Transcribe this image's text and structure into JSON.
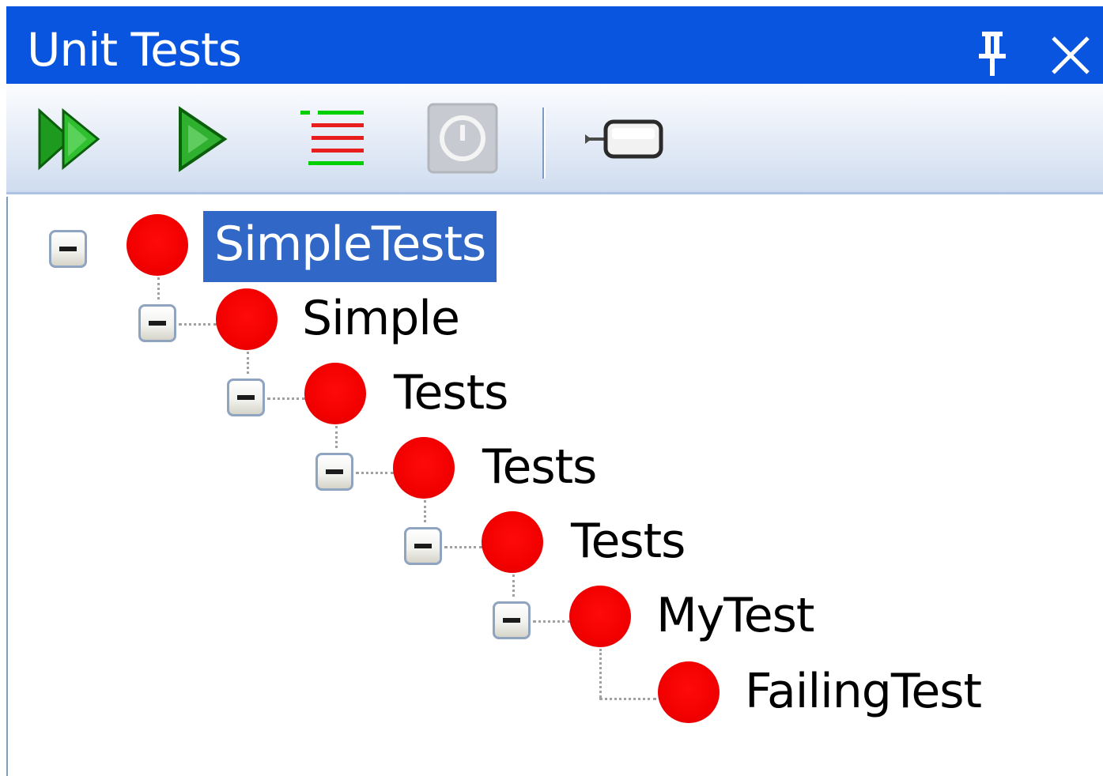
{
  "window": {
    "title": "Unit Tests",
    "titlebar_color": "#0a55e0"
  },
  "titlebar_buttons": [
    {
      "name": "pin",
      "icon": "pin-icon"
    },
    {
      "name": "close",
      "icon": "close-icon"
    }
  ],
  "toolbar": {
    "buttons": [
      {
        "name": "run-all",
        "icon": "double-play-icon"
      },
      {
        "name": "run",
        "icon": "play-icon"
      },
      {
        "name": "show-results",
        "icon": "results-list-icon"
      },
      {
        "name": "stop",
        "icon": "stop-icon",
        "enabled": false
      },
      {
        "name": "attach",
        "icon": "attach-icon"
      }
    ]
  },
  "tree": {
    "status_color": "#f20000",
    "selected_color": "#3168c8",
    "nodes": [
      {
        "label": "SimpleTests",
        "depth": 0,
        "status": "failed",
        "expanded": true,
        "selected": true
      },
      {
        "label": "Simple",
        "depth": 1,
        "status": "failed",
        "expanded": true,
        "selected": false
      },
      {
        "label": "Tests",
        "depth": 2,
        "status": "failed",
        "expanded": true,
        "selected": false
      },
      {
        "label": "Tests",
        "depth": 3,
        "status": "failed",
        "expanded": true,
        "selected": false
      },
      {
        "label": "Tests",
        "depth": 4,
        "status": "failed",
        "expanded": true,
        "selected": false
      },
      {
        "label": "MyTest",
        "depth": 5,
        "status": "failed",
        "expanded": true,
        "selected": false
      },
      {
        "label": "FailingTest",
        "depth": 6,
        "status": "failed",
        "leaf": true,
        "selected": false
      }
    ]
  }
}
